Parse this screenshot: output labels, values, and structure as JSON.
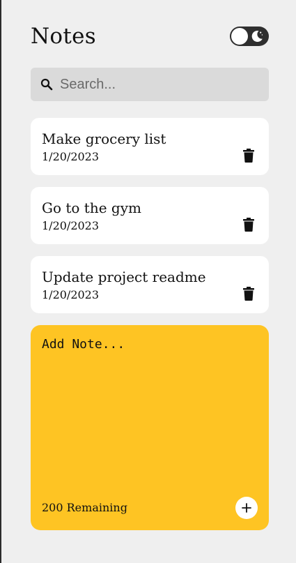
{
  "header": {
    "title": "Notes"
  },
  "theme_toggle": {
    "state": "dark",
    "icon": "moon-icon"
  },
  "search": {
    "value": "",
    "placeholder": "Search...",
    "icon": "search-icon"
  },
  "notes": [
    {
      "text": "Make grocery list",
      "date": "1/20/2023",
      "icon": "trash-icon"
    },
    {
      "text": "Go to the gym",
      "date": "1/20/2023",
      "icon": "trash-icon"
    },
    {
      "text": "Update project readme",
      "date": "1/20/2023",
      "icon": "trash-icon"
    }
  ],
  "new_note": {
    "placeholder": "Add Note...",
    "value": "",
    "remaining_label": "200 Remaining",
    "add_icon": "plus-icon"
  },
  "colors": {
    "page_background": "#efefef",
    "note_background": "#ffffff",
    "new_note_background": "#fec423",
    "toggle_background": "#2f2f2f",
    "search_background": "#dadada"
  }
}
